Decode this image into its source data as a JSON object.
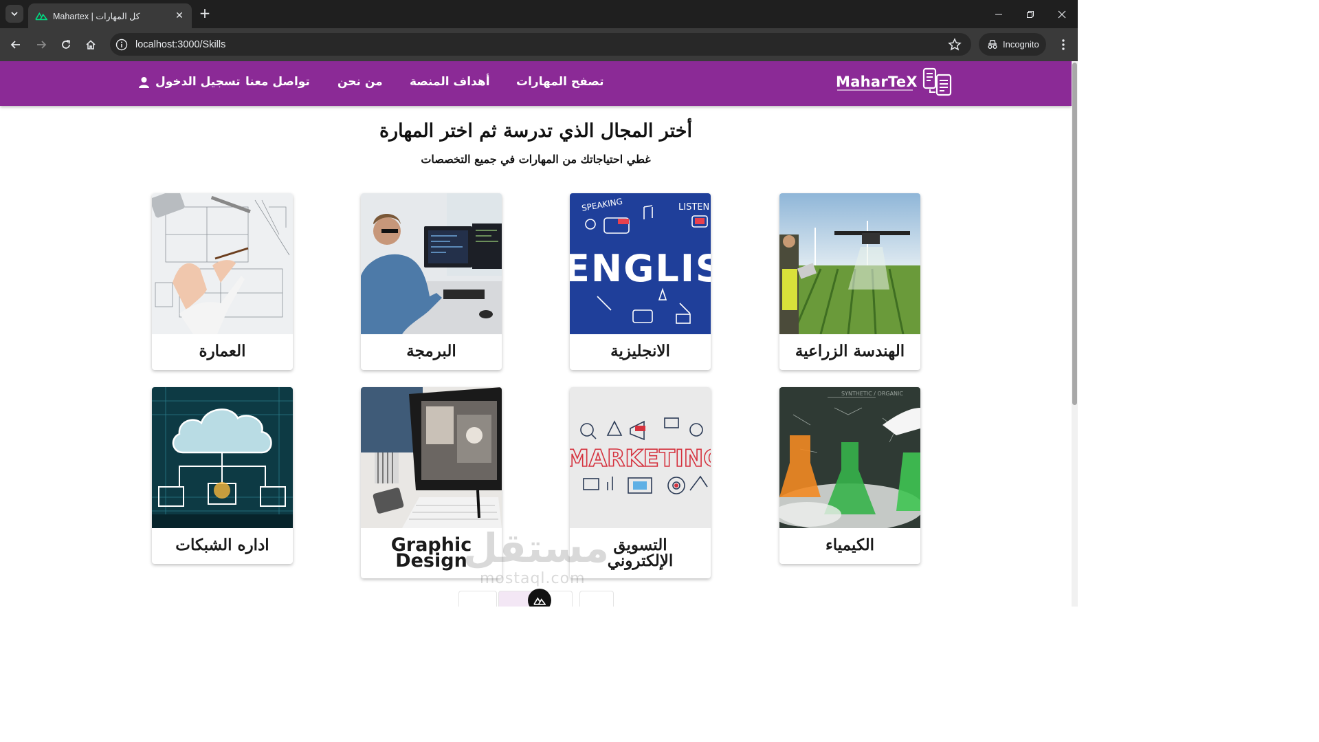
{
  "browser": {
    "tab_title": "Mahartex | كل المهارات",
    "url": "localhost:3000/Skills",
    "incognito_label": "Incognito"
  },
  "site": {
    "logo_text": "MaharTeX",
    "nav": {
      "browse": "تصفح المهارات",
      "goals": "أهداف المنصة",
      "about": "من نحن",
      "contact": "تواصل معنا",
      "login": "تسجيل الدخول"
    },
    "heading": "أختر المجال الذي تدرسة ثم اختر المهارة",
    "subheading": "غطي احتياجاتك من المهارات في جميع التخصصات"
  },
  "skills": [
    {
      "label": "الهندسة الزراعية",
      "image": "agri-drone-field"
    },
    {
      "label": "الانجليزية",
      "image": "english-doodles"
    },
    {
      "label": "البرمجة",
      "image": "programmer-desk"
    },
    {
      "label": "العمارة",
      "image": "architecture-blueprint"
    },
    {
      "label": "الكيمياء",
      "image": "chemistry-flasks"
    },
    {
      "label_line1": "التسويق",
      "label_line2": "الإلكتروني",
      "image": "marketing-icons"
    },
    {
      "label_line1": "Graphic",
      "label_line2": "Design",
      "image": "graphic-design-desk"
    },
    {
      "label": "اداره الشبكات",
      "image": "network-cloud"
    }
  ],
  "watermark": {
    "text": "مستقل",
    "sub": "mostaql.com"
  },
  "colors": {
    "brand": "#8b2a96",
    "chrome_dark": "#1f1f1f",
    "chrome_toolbar": "#3a3a3a"
  }
}
